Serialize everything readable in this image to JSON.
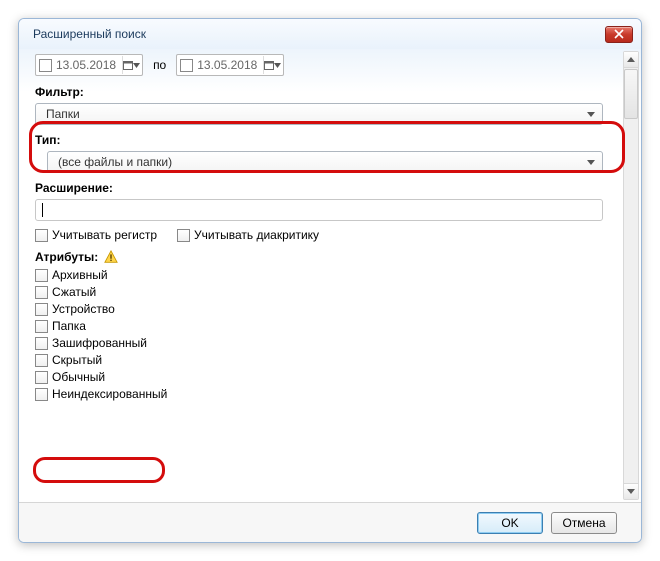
{
  "window": {
    "title": "Расширенный поиск"
  },
  "date": {
    "from": "13.05.2018",
    "sep": "по",
    "to": "13.05.2018"
  },
  "filter": {
    "label": "Фильтр:",
    "value": "Папки"
  },
  "type": {
    "label": "Тип:",
    "value": "(все файлы и папки)"
  },
  "extension": {
    "label": "Расширение:"
  },
  "checks": {
    "case": "Учитывать регистр",
    "diacritics": "Учитывать диакритику"
  },
  "attributes": {
    "label": "Атрибуты:",
    "items": [
      "Архивный",
      "Сжатый",
      "Устройство",
      "Папка",
      "Зашифрованный",
      "Скрытый",
      "Обычный",
      "Неиндексированный"
    ]
  },
  "buttons": {
    "ok": "OK",
    "cancel": "Отмена"
  }
}
